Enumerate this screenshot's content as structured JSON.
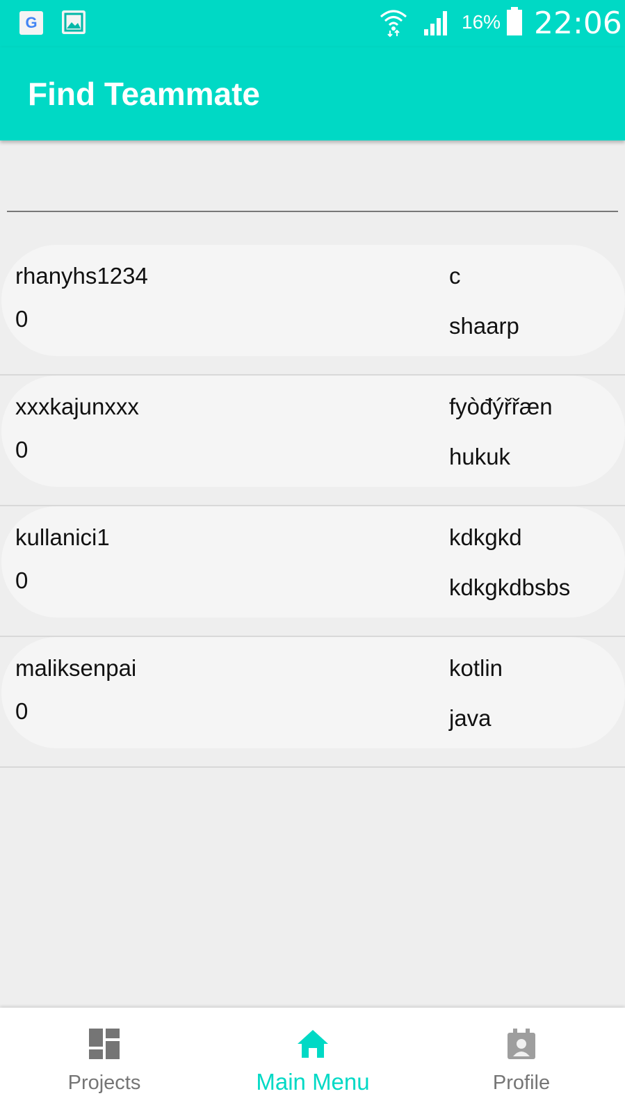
{
  "status_bar": {
    "google_icon_letter": "G",
    "battery_percent": "16%",
    "time": "22:06",
    "icons": [
      "google-icon",
      "gallery-icon",
      "wifi-icon",
      "signal-icon",
      "battery-icon"
    ]
  },
  "app_bar": {
    "title": "Find Teammate",
    "color": "#00d9c5"
  },
  "search": {
    "value": ""
  },
  "users": [
    {
      "name": "rhanyhs1234",
      "score": "0",
      "skill1": "c",
      "skill2": "shaarp"
    },
    {
      "name": "xxxkajunxxx",
      "score": "0",
      "skill1": "fyòđýřřæn",
      "skill2": "hukuk"
    },
    {
      "name": "kullanici1",
      "score": "0",
      "skill1": "kdkgkd",
      "skill2": "kdkgkdbsbs"
    },
    {
      "name": "maliksenpai",
      "score": "0",
      "skill1": "kotlin",
      "skill2": "java"
    }
  ],
  "bottom_nav": {
    "items": [
      {
        "label": "Projects",
        "icon": "dashboard-icon",
        "active": false
      },
      {
        "label": "Main Menu",
        "icon": "home-icon",
        "active": true
      },
      {
        "label": "Profile",
        "icon": "profile-badge-icon",
        "active": false
      }
    ],
    "active_color": "#00d9c5",
    "inactive_color": "#757575"
  }
}
